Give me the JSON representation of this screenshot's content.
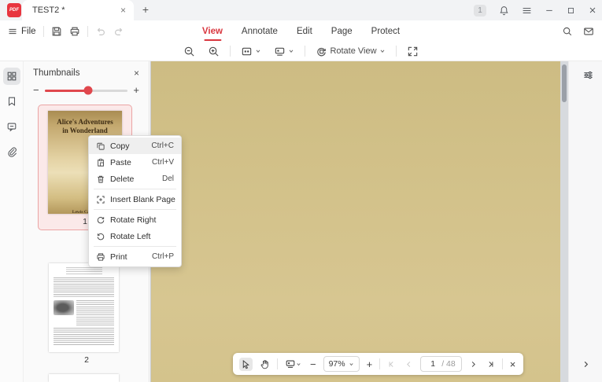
{
  "app": {
    "logo_text": "PDF",
    "accent_color": "#d9363e",
    "document_page_color": "#d2c189"
  },
  "titlebar": {
    "tab_title": "TEST2 *",
    "tab_close": "×",
    "new_tab": "+",
    "notification_badge": "1",
    "minimize": "—",
    "close": "×"
  },
  "menubar": {
    "file_label": "File",
    "items": [
      {
        "label": "View",
        "active": true
      },
      {
        "label": "Annotate",
        "active": false
      },
      {
        "label": "Edit",
        "active": false
      },
      {
        "label": "Page",
        "active": false
      },
      {
        "label": "Protect",
        "active": false
      }
    ]
  },
  "toolbar": {
    "rotate_view_label": "Rotate View"
  },
  "sidebar": {
    "items": [
      "thumbnails",
      "bookmarks",
      "comments",
      "attachments"
    ]
  },
  "thumbnails_panel": {
    "title": "Thumbnails",
    "close": "×",
    "slider_minus": "−",
    "slider_plus": "+",
    "pages": [
      {
        "number": "1",
        "selected": true,
        "cover_title_line1": "Alice's Adventures",
        "cover_title_line2": "in Wonderland",
        "cover_author": "Lewis Carroll"
      },
      {
        "number": "2",
        "selected": false
      }
    ]
  },
  "context_menu": {
    "items": [
      {
        "label": "Copy",
        "shortcut": "Ctrl+C",
        "hovered": true
      },
      {
        "label": "Paste",
        "shortcut": "Ctrl+V",
        "hovered": false
      },
      {
        "label": "Delete",
        "shortcut": "Del",
        "hovered": false
      },
      {
        "label": "Insert Blank Page",
        "shortcut": "",
        "hovered": false
      },
      {
        "label": "Rotate Right",
        "shortcut": "",
        "hovered": false
      },
      {
        "label": "Rotate Left",
        "shortcut": "",
        "hovered": false
      },
      {
        "label": "Print",
        "shortcut": "Ctrl+P",
        "hovered": false
      }
    ]
  },
  "bottom_toolbar": {
    "zoom_value": "97%",
    "minus": "−",
    "plus": "+",
    "page_current": "1",
    "page_total": "/ 48",
    "close": "×"
  }
}
